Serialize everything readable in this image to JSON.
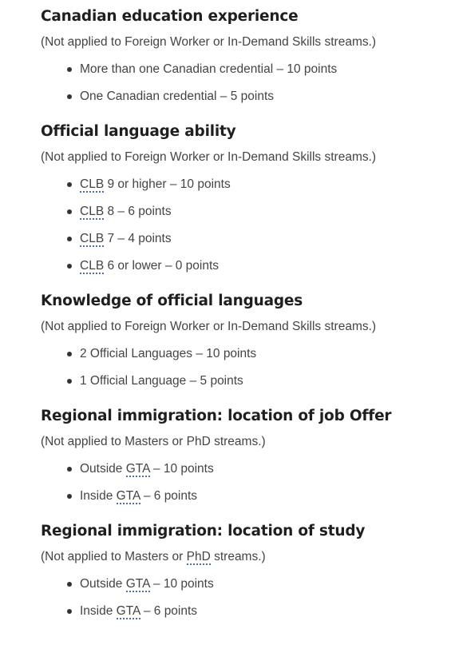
{
  "sections": [
    {
      "heading": "Canadian education experience",
      "note": "(Not applied to Foreign Worker or In-Demand Skills streams.)",
      "items": [
        {
          "abbr": "",
          "text": "More than one Canadian credential – 10 points"
        },
        {
          "abbr": "",
          "text": "One Canadian credential – 5 points"
        }
      ]
    },
    {
      "heading": "Official language ability",
      "note": "(Not applied to Foreign Worker or In-Demand Skills streams.)",
      "items": [
        {
          "abbr": "CLB",
          "text": " 9 or higher – 10 points"
        },
        {
          "abbr": "CLB",
          "text": " 8 – 6 points"
        },
        {
          "abbr": "CLB",
          "text": " 7 – 4 points"
        },
        {
          "abbr": "CLB",
          "text": " 6 or lower – 0 points"
        }
      ]
    },
    {
      "heading": "Knowledge of official languages",
      "note": "(Not applied to Foreign Worker or In-Demand Skills streams.)",
      "items": [
        {
          "abbr": "",
          "text": "2 Official Languages – 10 points"
        },
        {
          "abbr": "",
          "text": "1 Official Language – 5 points"
        }
      ]
    },
    {
      "heading": "Regional immigration: location of job Offer",
      "note": "(Not applied to Masters or PhD streams.)",
      "items": [
        {
          "pre": "Outside ",
          "abbr": "GTA",
          "text": " – 10 points"
        },
        {
          "pre": "Inside ",
          "abbr": "GTA",
          "text": " – 6 points"
        }
      ]
    },
    {
      "heading": "Regional immigration: location of study",
      "note_pre": "(Not applied to Masters or ",
      "note_abbr": "PhD",
      "note_post": " streams.)",
      "items": [
        {
          "pre": "Outside ",
          "abbr": "GTA",
          "text": " – 10 points"
        },
        {
          "pre": "Inside ",
          "abbr": "GTA",
          "text": " – 6 points"
        }
      ]
    }
  ]
}
